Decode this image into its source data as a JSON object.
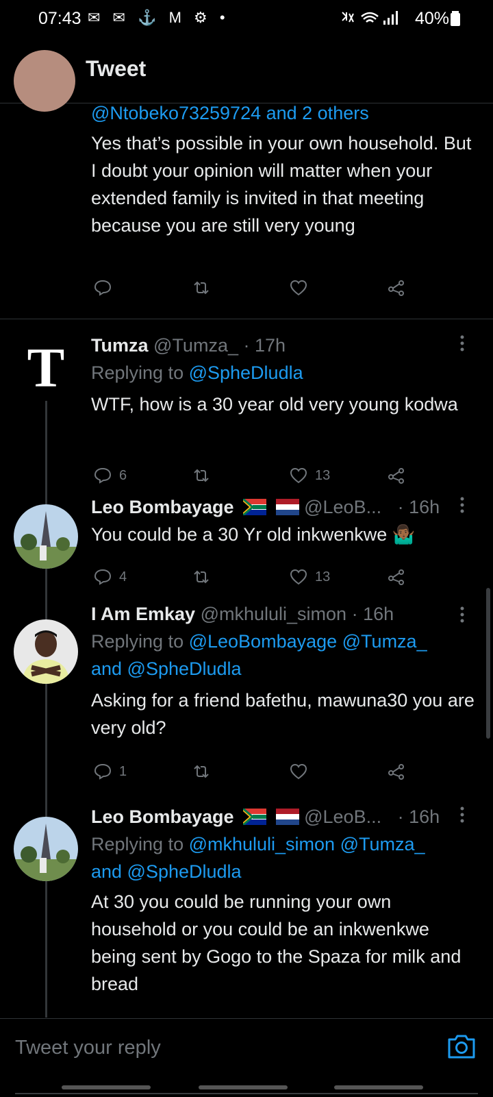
{
  "status_bar": {
    "time": "07:43",
    "left_icons": "✉ ✉ ⚓ M ⚙ •",
    "right_text": "40%"
  },
  "header": {
    "title": "Tweet"
  },
  "tweets": [
    {
      "mentions": "@Ntobeko73259724 and 2 others",
      "text": "Yes that’s possible in your own household. But I doubt your opinion will matter when your extended family is invited in that meeting because you are still very young",
      "replies": "",
      "likes": ""
    },
    {
      "name": "Tumza",
      "handle": "@Tumza_",
      "time": "· 17h",
      "replying_prefix": "Replying to ",
      "replying_to": "@SpheDludla",
      "text": "WTF, how is a 30 year old very young kodwa",
      "replies": "6",
      "likes": "13",
      "avatar_letter": "T"
    },
    {
      "name": "Leo Bombayage",
      "handle": "@LeoB...",
      "time": "· 16h",
      "text": "You could be a 30 Yr old inkwenkwe",
      "emoji": "🤷🏾‍♂️",
      "replies": "4",
      "likes": "13"
    },
    {
      "name": "I Am Emkay",
      "handle": "@mkhululi_simon",
      "time": "· 16h",
      "replying_prefix": "Replying to ",
      "replying_to": "@LeoBombayage @Tumza_",
      "replying_to_2": "and @SpheDludla",
      "text": "Asking for a friend bafethu, mawuna30 you are very old?",
      "replies": "1",
      "likes": ""
    },
    {
      "name": "Leo Bombayage",
      "handle": "@LeoB...",
      "time": "· 16h",
      "replying_prefix": "Replying to ",
      "replying_to": "@mkhululi_simon @Tumza_",
      "replying_to_2": "and @SpheDludla",
      "text": "At 30 you could be running your own household or you could be an inkwenkwe being sent by Gogo to the Spaza for milk and bread"
    }
  ],
  "reply_bar": {
    "placeholder": "Tweet your reply"
  },
  "colors": {
    "background": "#000000",
    "link": "#1d9bf0",
    "muted": "#71767b",
    "text": "#e7e9ea"
  },
  "icons": [
    "back-arrow-icon",
    "reply-icon",
    "retweet-icon",
    "like-icon",
    "share-icon",
    "more-icon",
    "camera-icon"
  ]
}
